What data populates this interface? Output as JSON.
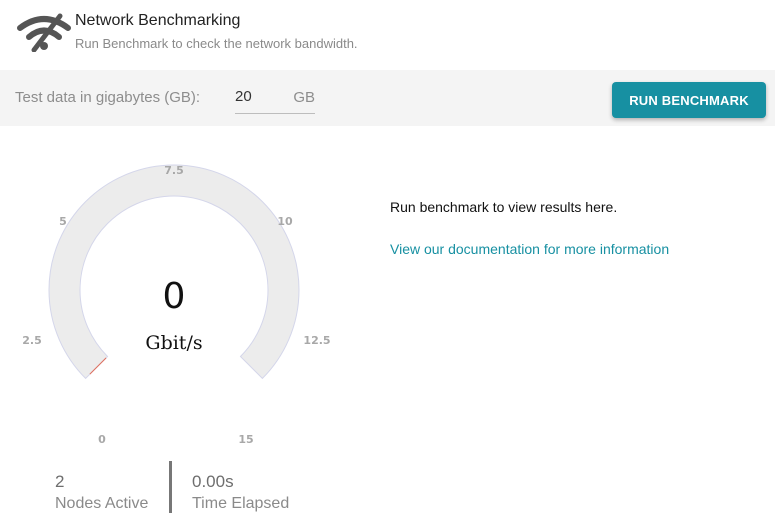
{
  "header": {
    "logo_icon": "wifi-signal-icon",
    "title": "Network Benchmarking",
    "subtitle": "Run Benchmark to check the network bandwidth."
  },
  "toolbar": {
    "test_data_label": "Test data in gigabytes (GB):",
    "test_data_value": "20",
    "test_data_unit": "GB",
    "run_button_label": "RUN BENCHMARK",
    "accent_color": "#1790a2"
  },
  "gauge": {
    "value": "0",
    "unit": "Gbit/s",
    "min": 0,
    "max": 15,
    "current": 0,
    "ticks": [
      "0",
      "2.5",
      "5",
      "7.5",
      "10",
      "12.5",
      "15"
    ]
  },
  "stats": {
    "nodes_value": "2",
    "nodes_label": "Nodes Active",
    "time_value": "0.00s",
    "time_label": "Time Elapsed"
  },
  "results": {
    "message": "Run benchmark to view results here.",
    "doc_link": "View our documentation for more information"
  }
}
